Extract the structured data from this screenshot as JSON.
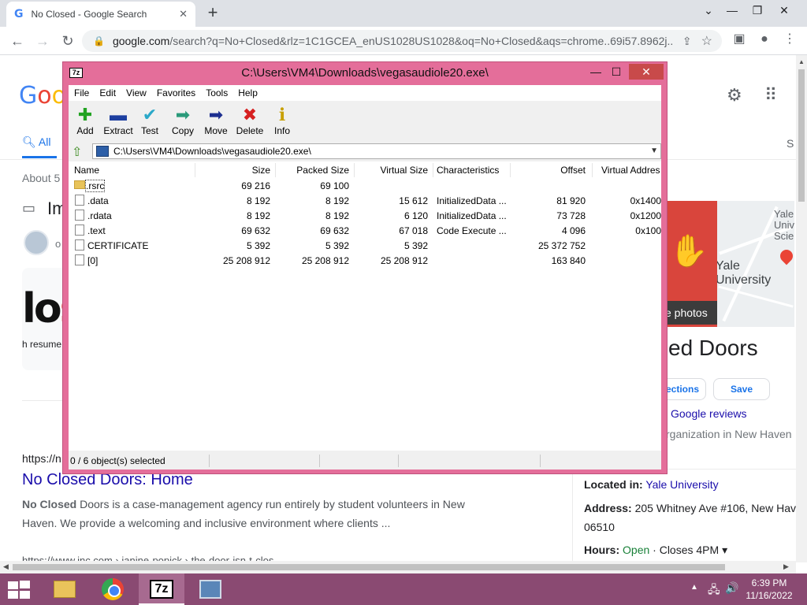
{
  "browser": {
    "tab_title": "No Closed - Google Search",
    "tab_icon": "G",
    "close_tab": "✕",
    "new_tab": "+",
    "url_main": "google.com",
    "url_rest": "/search?q=No+Closed&rlz=1C1GCEA_enUS1028US1028&oq=No+Closed&aqs=chrome..69i57.8962j..."
  },
  "google": {
    "all_tab": "All",
    "s_tab": "S",
    "about": "About 5",
    "images_label": "Im",
    "avatar_text": "o",
    "big_text_black": "lo",
    "big_text_red": "s",
    "resume": "h resume",
    "result1_url": "https://n",
    "result1_title": "No Closed Doors: Home",
    "result1_bold": "No Closed",
    "result1_snippet": " Doors is a case-management agency run entirely by student volunteers in New Haven. We provide a welcoming and inclusive environment where clients ...",
    "result2_url": "https://www.inc.com › janine-popick › the-door-isn-t-clos...",
    "kp": {
      "photos_btn": "e photos",
      "map_label_1": "Yale Univer Scienc",
      "map_label_2": "Yale University",
      "title": "ed Doors",
      "directions": "rections",
      "save": "Save",
      "reviews": "Google reviews",
      "org": "rganization in New Haven",
      "located_label": "Located in:",
      "located_value": "Yale University",
      "address_label": "Address:",
      "address_value": "205 Whitney Ave #106, New Have",
      "zip": "06510",
      "hours_label": "Hours:",
      "hours_open": "Open",
      "hours_rest": " · Closes 4PM ▾"
    }
  },
  "sevenzip": {
    "caption": "C:\\Users\\VM4\\Downloads\\vegasaudiole20.exe\\",
    "icon_text": "7z",
    "menu": [
      "File",
      "Edit",
      "View",
      "Favorites",
      "Tools",
      "Help"
    ],
    "toolbar": [
      {
        "label": "Add",
        "icon": "plus-icon",
        "glyph": "✚",
        "color": "#22a322"
      },
      {
        "label": "Extract",
        "icon": "minus-icon",
        "glyph": "▬",
        "color": "#1d3fa0"
      },
      {
        "label": "Test",
        "icon": "check-icon",
        "glyph": "✔",
        "color": "#2aa8c8"
      },
      {
        "label": "Copy",
        "icon": "copy-arrow-icon",
        "glyph": "➡",
        "color": "#2a9a7a"
      },
      {
        "label": "Move",
        "icon": "move-arrow-icon",
        "glyph": "➡",
        "color": "#1d2f90"
      },
      {
        "label": "Delete",
        "icon": "delete-x-icon",
        "glyph": "✖",
        "color": "#d62020"
      },
      {
        "label": "Info",
        "icon": "info-icon",
        "glyph": "ℹ",
        "color": "#c8a000"
      }
    ],
    "address": "C:\\Users\\VM4\\Downloads\\vegasaudiole20.exe\\",
    "columns": [
      "Name",
      "Size",
      "Packed Size",
      "Virtual Size",
      "Characteristics",
      "Offset",
      "Virtual Addres"
    ],
    "rows": [
      {
        "name": ".rsrc",
        "type": "folder",
        "size": "69 216",
        "packed": "69 100",
        "vsize": "",
        "chars": "",
        "offset": "",
        "vaddr": ""
      },
      {
        "name": ".data",
        "type": "file",
        "size": "8 192",
        "packed": "8 192",
        "vsize": "15 612",
        "chars": "InitializedData ...",
        "offset": "81 920",
        "vaddr": "0x1400"
      },
      {
        "name": ".rdata",
        "type": "file",
        "size": "8 192",
        "packed": "8 192",
        "vsize": "6 120",
        "chars": "InitializedData ...",
        "offset": "73 728",
        "vaddr": "0x1200"
      },
      {
        "name": ".text",
        "type": "file",
        "size": "69 632",
        "packed": "69 632",
        "vsize": "67 018",
        "chars": "Code Execute ...",
        "offset": "4 096",
        "vaddr": "0x100"
      },
      {
        "name": "CERTIFICATE",
        "type": "file",
        "size": "5 392",
        "packed": "5 392",
        "vsize": "5 392",
        "chars": "",
        "offset": "25 372 752",
        "vaddr": ""
      },
      {
        "name": "[0]",
        "type": "file",
        "size": "25 208 912",
        "packed": "25 208 912",
        "vsize": "25 208 912",
        "chars": "",
        "offset": "163 840",
        "vaddr": ""
      }
    ],
    "status": "0 / 6 object(s) selected"
  },
  "taskbar": {
    "time": "6:39 PM",
    "date": "11/16/2022",
    "sevenzip_label": "7z"
  }
}
